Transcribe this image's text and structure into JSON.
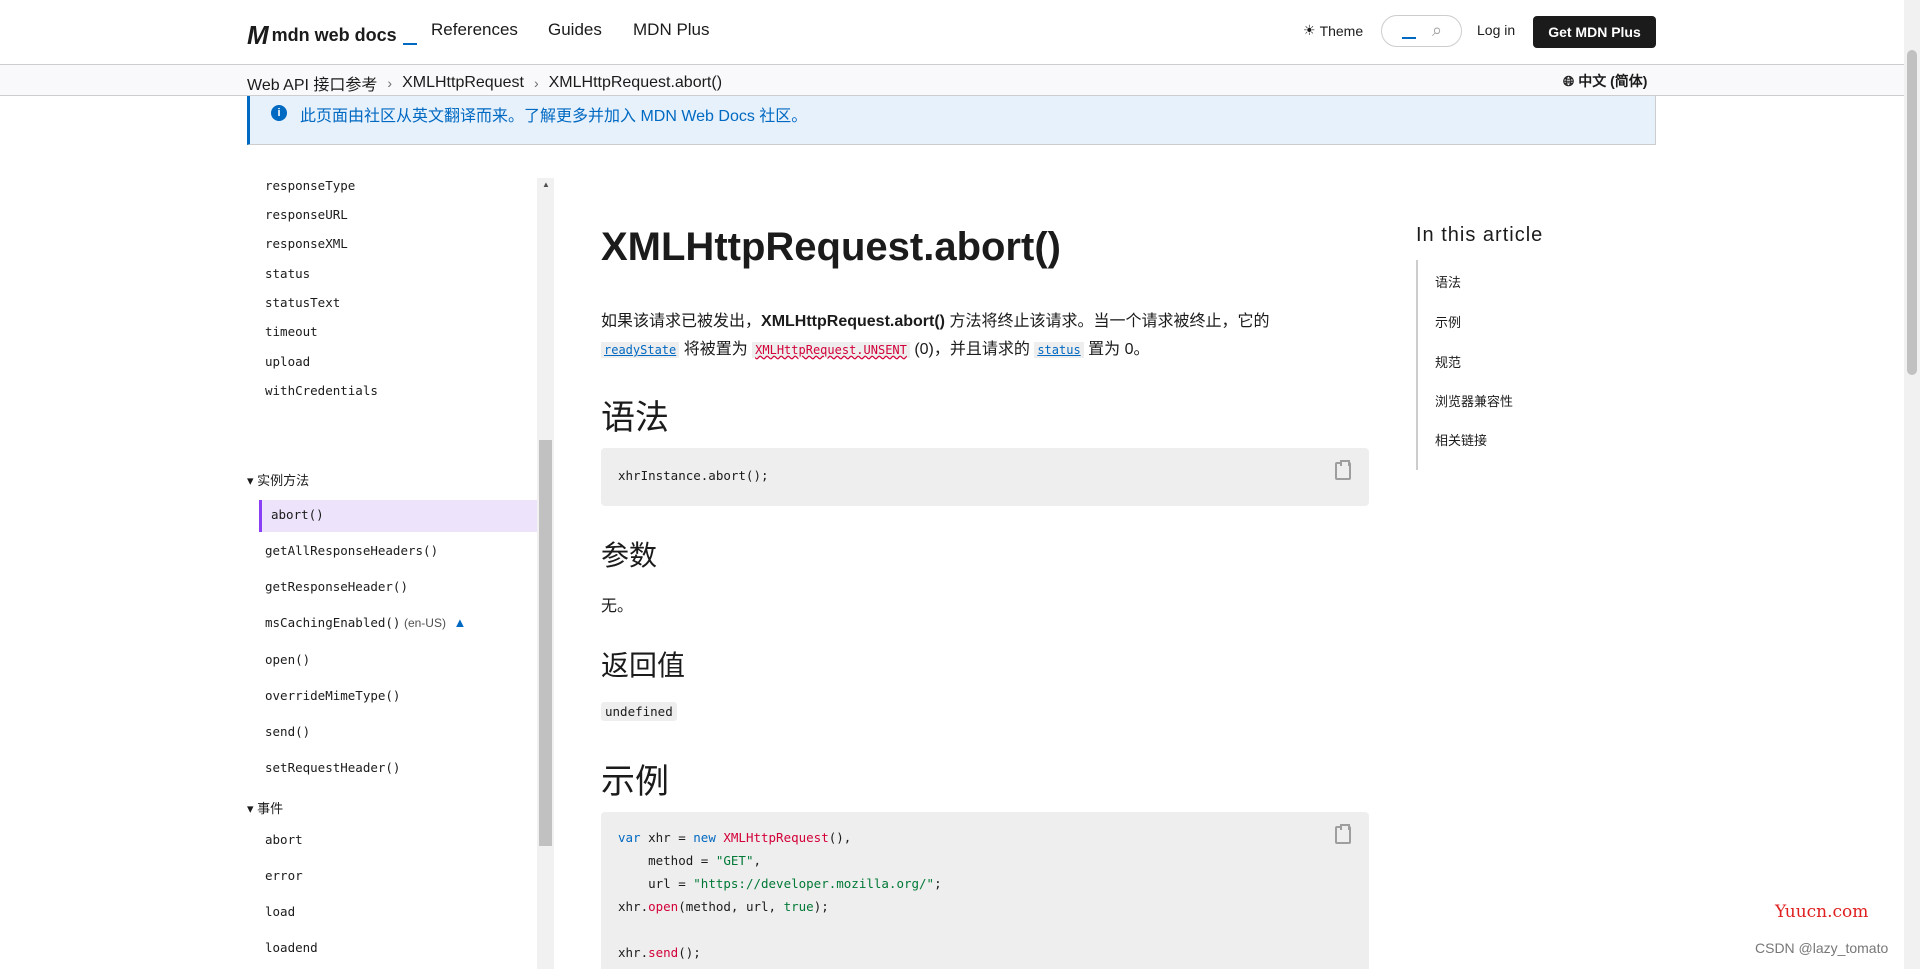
{
  "header": {
    "logo_text": "mdn web docs",
    "nav": [
      "References",
      "Guides",
      "MDN Plus"
    ],
    "theme_label": "Theme",
    "login_label": "Log in",
    "get_plus_label": "Get MDN Plus"
  },
  "breadcrumbs": [
    "Web API 接口参考",
    "XMLHttpRequest",
    "XMLHttpRequest.abort()"
  ],
  "language": "中文 (简体)",
  "notice": "此页面由社区从英文翻译而来。了解更多并加入 MDN Web Docs 社区。",
  "sidebar": {
    "properties": [
      "responseType",
      "responseURL",
      "responseXML",
      "status",
      "statusText",
      "timeout",
      "upload",
      "withCredentials"
    ],
    "methods_heading": "实例方法",
    "active_method": "abort()",
    "methods": [
      "getAllResponseHeaders()",
      "getResponseHeader()",
      "msCachingEnabled()",
      "open()",
      "overrideMimeType()",
      "send()",
      "setRequestHeader()"
    ],
    "ms_caching_locale": "(en-US)",
    "events_heading": "事件",
    "events": [
      "abort",
      "error",
      "load",
      "loadend"
    ]
  },
  "article": {
    "title": "XMLHttpRequest.abort()",
    "intro_part1": "如果该请求已被发出，",
    "intro_strong": "XMLHttpRequest.abort()",
    "intro_part2": " 方法将终止该请求。当一个请求被终止，它的",
    "intro_readystate": "readyState",
    "intro_part3": " 将被置为 ",
    "intro_unsent": "XMLHttpRequest.UNSENT",
    "intro_part4": " (0)，并且请求的 ",
    "intro_status": "status",
    "intro_part5": " 置为 0。",
    "syntax_heading": "语法",
    "syntax_code": "xhrInstance.abort();",
    "params_heading": "参数",
    "params_text": "无。",
    "return_heading": "返回值",
    "return_value": "undefined",
    "example_heading": "示例",
    "example_code": {
      "l1_var": "var",
      "l1_a": " xhr = ",
      "l1_new": "new",
      "l1_ctor": " XMLHttpRequest",
      "l1_b": "(),",
      "l2_a": "    method = ",
      "l2_str": "\"GET\"",
      "l2_b": ",",
      "l3_a": "    url = ",
      "l3_str": "\"https://developer.mozilla.org/\"",
      "l3_b": ";",
      "l4_a": "xhr.",
      "l4_fn": "open",
      "l4_b": "(method, url, ",
      "l4_bool": "true",
      "l4_c": ");",
      "l5_a": "xhr.",
      "l5_fn": "send",
      "l5_b": "();"
    }
  },
  "toc": {
    "title": "In this article",
    "items": [
      "语法",
      "示例",
      "规范",
      "浏览器兼容性",
      "相关链接"
    ]
  },
  "watermarks": {
    "site": "Yuucn.com",
    "csdn": "CSDN @lazy_tomato"
  }
}
